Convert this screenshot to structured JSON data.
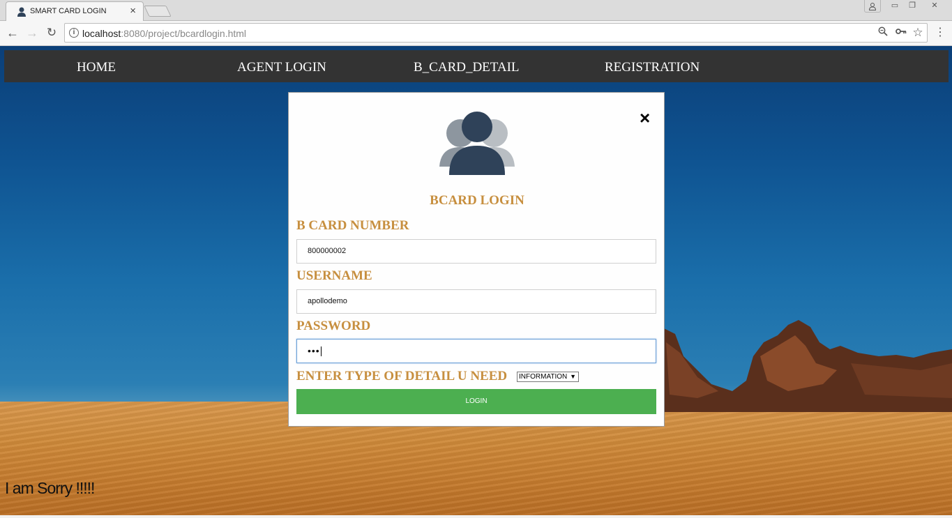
{
  "browser": {
    "tab_title": "SMART CARD LOGIN",
    "tab_close": "×",
    "url_host": "localhost",
    "url_rest": ":8080/project/bcardlogin.html",
    "window_controls": {
      "minimize": "▭",
      "maximize": "❐",
      "close": "✕"
    },
    "icons": [
      "back-arrow",
      "forward-arrow",
      "reload",
      "info",
      "zoom",
      "key",
      "star",
      "kebab-menu",
      "user"
    ]
  },
  "nav": {
    "home": "HOME",
    "agent_login": "AGENT LOGIN",
    "bcard_detail": "B_CARD_DETAIL",
    "registration": "REGISTRATION"
  },
  "modal": {
    "close": "×",
    "title": "BCARD LOGIN",
    "card_label": "B CARD NUMBER",
    "card_value": "800000002",
    "username_label": "USERNAME",
    "username_value": "apollodemo",
    "password_label": "PASSWORD",
    "password_masked": "•••",
    "type_label": "ENTER TYPE OF DETAIL U NEED",
    "type_selected": "INFORMATION",
    "login_button": "LOGIN"
  },
  "footer_text": "I am Sorry !!!!!",
  "colors": {
    "nav_bg": "#333333",
    "label_gold": "#c78f3f",
    "login_green": "#4caf50",
    "avatar_dark": "#2f4259"
  }
}
